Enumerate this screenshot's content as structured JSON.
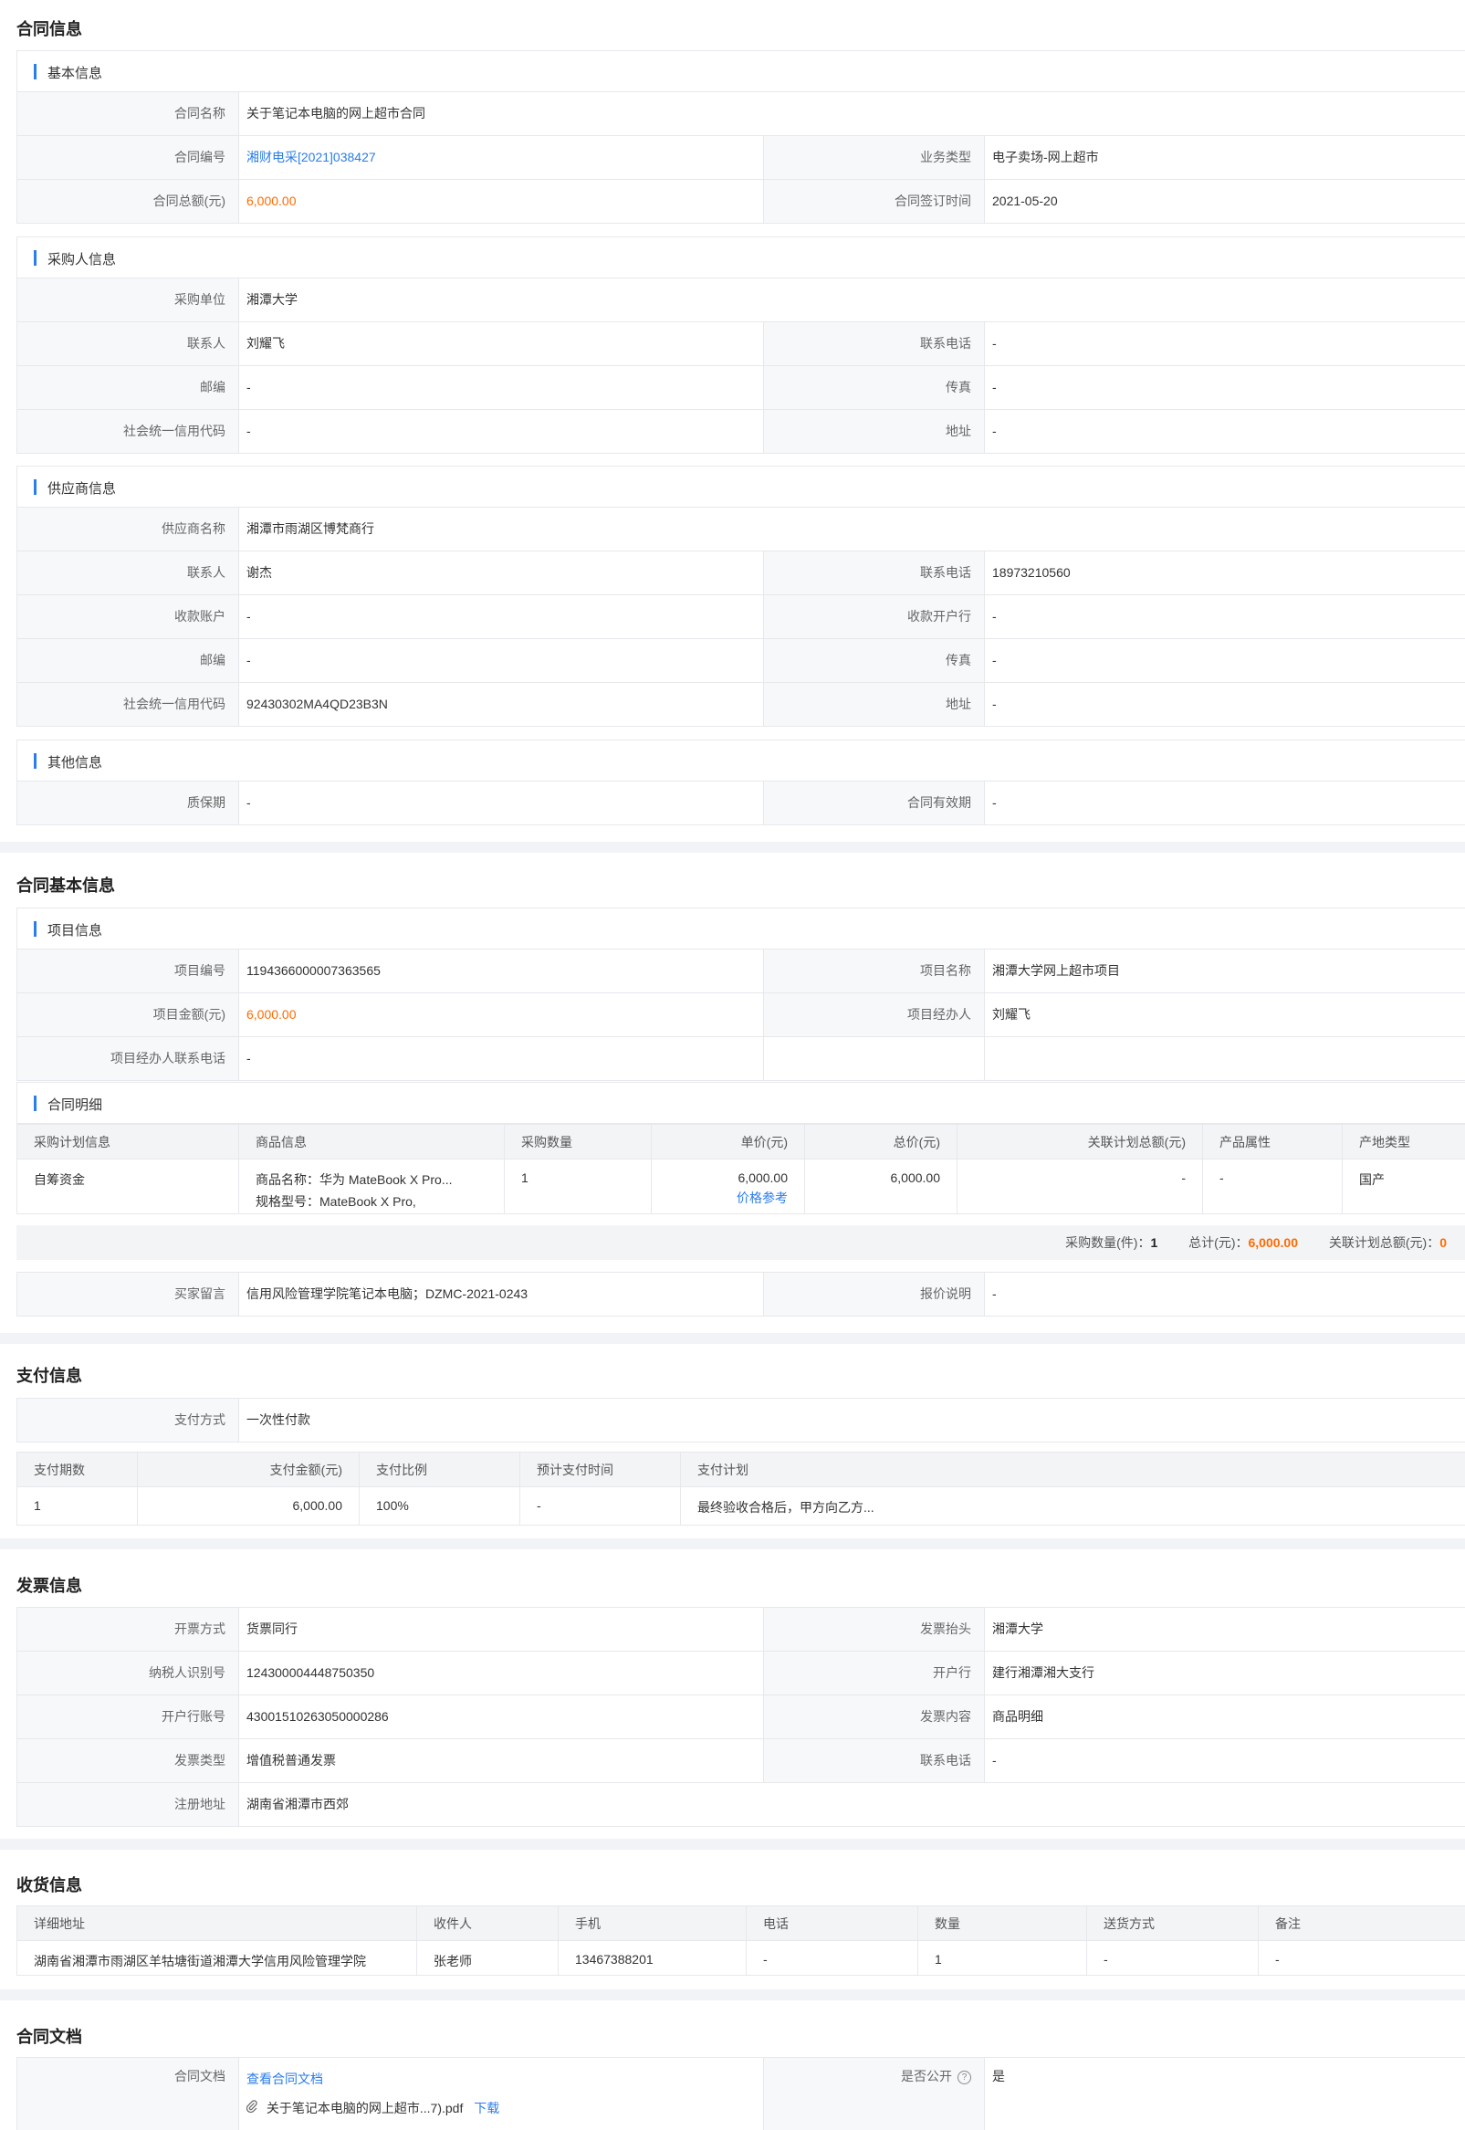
{
  "contract_info": {
    "title": "合同信息",
    "basic": {
      "heading": "基本信息",
      "name_label": "合同名称",
      "name": "关于笔记本电脑的网上超市合同",
      "no_label": "合同编号",
      "no": "湘财电采[2021]038427",
      "biz_label": "业务类型",
      "biz": "电子卖场-网上超市",
      "total_label": "合同总额(元)",
      "total": "6,000.00",
      "sign_label": "合同签订时间",
      "sign": "2021-05-20"
    },
    "buyer": {
      "heading": "采购人信息",
      "unit_label": "采购单位",
      "unit": "湘潭大学",
      "contact_label": "联系人",
      "contact": "刘耀飞",
      "phone_label": "联系电话",
      "phone": "-",
      "zip_label": "邮编",
      "zip": "-",
      "fax_label": "传真",
      "fax": "-",
      "credit_label": "社会统一信用代码",
      "credit": "-",
      "addr_label": "地址",
      "addr": "-"
    },
    "supplier": {
      "heading": "供应商信息",
      "name_label": "供应商名称",
      "name": "湘潭市雨湖区博梵商行",
      "contact_label": "联系人",
      "contact": "谢杰",
      "phone_label": "联系电话",
      "phone": "18973210560",
      "acct_label": "收款账户",
      "acct": "-",
      "bank_label": "收款开户行",
      "bank": "-",
      "zip_label": "邮编",
      "zip": "-",
      "fax_label": "传真",
      "fax": "-",
      "credit_label": "社会统一信用代码",
      "credit": "92430302MA4QD23B3N",
      "addr_label": "地址",
      "addr": "-"
    },
    "other": {
      "heading": "其他信息",
      "warranty_label": "质保期",
      "warranty": "-",
      "valid_label": "合同有效期",
      "valid": "-"
    }
  },
  "contract_basic": {
    "title": "合同基本信息",
    "project": {
      "heading": "项目信息",
      "no_label": "项目编号",
      "no": "1194366000007363565",
      "name_label": "项目名称",
      "name": "湘潭大学网上超市项目",
      "amount_label": "项目金额(元)",
      "amount": "6,000.00",
      "manager_label": "项目经办人",
      "manager": "刘耀飞",
      "manager_phone_label": "项目经办人联系电话",
      "manager_phone": "-"
    },
    "detail": {
      "heading": "合同明细",
      "columns": [
        "采购计划信息",
        "商品信息",
        "采购数量",
        "单价(元)",
        "总价(元)",
        "关联计划总额(元)",
        "产品属性",
        "产地类型"
      ],
      "row": {
        "plan": "自筹资金",
        "goods_name": "商品名称：华为 MateBook X Pro...",
        "goods_model": "规格型号：MateBook X Pro,",
        "qty": "1",
        "price": "6,000.00",
        "price_ref": "价格参考",
        "total": "6,000.00",
        "plan_total": "-",
        "attr": "-",
        "origin": "国产"
      },
      "summary_qty_label": "采购数量(件)：",
      "summary_qty": "1",
      "summary_total_label": "总计(元)：",
      "summary_total": "6,000.00",
      "summary_plan_label": "关联计划总额(元)：",
      "summary_plan": "0"
    },
    "buyer_msg_label": "买家留言",
    "buyer_msg": "信用风险管理学院笔记本电脑；DZMC-2021-0243",
    "quote_label": "报价说明",
    "quote": "-"
  },
  "payment": {
    "title": "支付信息",
    "method_label": "支付方式",
    "method": "一次性付款",
    "columns": [
      "支付期数",
      "支付金额(元)",
      "支付比例",
      "预计支付时间",
      "支付计划"
    ],
    "row": {
      "period": "1",
      "amount": "6,000.00",
      "ratio": "100%",
      "time": "-",
      "plan": "最终验收合格后，甲方向乙方..."
    }
  },
  "invoice": {
    "title": "发票信息",
    "mode_label": "开票方式",
    "mode": "货票同行",
    "header_label": "发票抬头",
    "header": "湘潭大学",
    "taxid_label": "纳税人识别号",
    "taxid": "124300004448750350",
    "bank_label": "开户行",
    "bank": "建行湘潭湘大支行",
    "acct_label": "开户行账号",
    "acct": "43001510263050000286",
    "content_label": "发票内容",
    "content": "商品明细",
    "type_label": "发票类型",
    "type": "增值税普通发票",
    "phone_label": "联系电话",
    "phone": "-",
    "reg_label": "注册地址",
    "reg": "湖南省湘潭市西郊"
  },
  "delivery": {
    "title": "收货信息",
    "columns": [
      "详细地址",
      "收件人",
      "手机",
      "电话",
      "数量",
      "送货方式",
      "备注"
    ],
    "row": {
      "addr": "湖南省湘潭市雨湖区羊牯塘街道湘潭大学信用风险管理学院",
      "receiver": "张老师",
      "mobile": "13467388201",
      "phone": "-",
      "qty": "1",
      "ship": "-",
      "note": "-"
    }
  },
  "docs": {
    "title": "合同文档",
    "doc_label": "合同文档",
    "doc_link": "查看合同文档",
    "file": "关于笔记本电脑的网上超市...7).pdf",
    "download": "下载",
    "public_label": "是否公开",
    "public": "是"
  },
  "colors": {
    "accent": "#2b7de9",
    "amount": "#ff6a00",
    "band": "#f1f3f7"
  },
  "icons": [
    "help-icon",
    "paperclip-icon"
  ]
}
